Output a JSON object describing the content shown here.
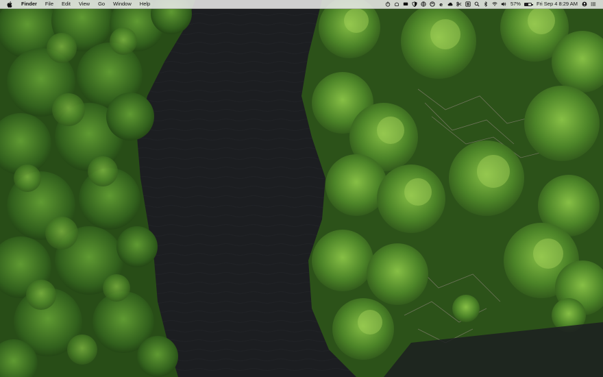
{
  "menubar": {
    "app_name": "Finder",
    "menus": [
      "File",
      "Edit",
      "View",
      "Go",
      "Window",
      "Help"
    ],
    "status_icons": [
      "timer-icon",
      "alfred-hat-icon",
      "screen-icon",
      "shield-icon",
      "globe-icon",
      "sync-icon",
      "e-app-icon",
      "cloud-icon",
      "scissors-icon",
      "bartender-icon",
      "bluetooth-icon",
      "volume-icon"
    ],
    "battery_percent_label": "57%",
    "battery_level": 0.57,
    "clock": "Fri Sep 4  8:29 AM",
    "right_icons": [
      "search-icon",
      "wifi-icon",
      "user-icon",
      "list-icon"
    ]
  },
  "desktop": {
    "wallpaper": "aerial-river-mangroves",
    "colors": {
      "water": "#1d1f22",
      "foliage_dark": "#2f5a1f",
      "foliage_mid": "#4f8a2a",
      "foliage_light": "#8cc046"
    }
  }
}
